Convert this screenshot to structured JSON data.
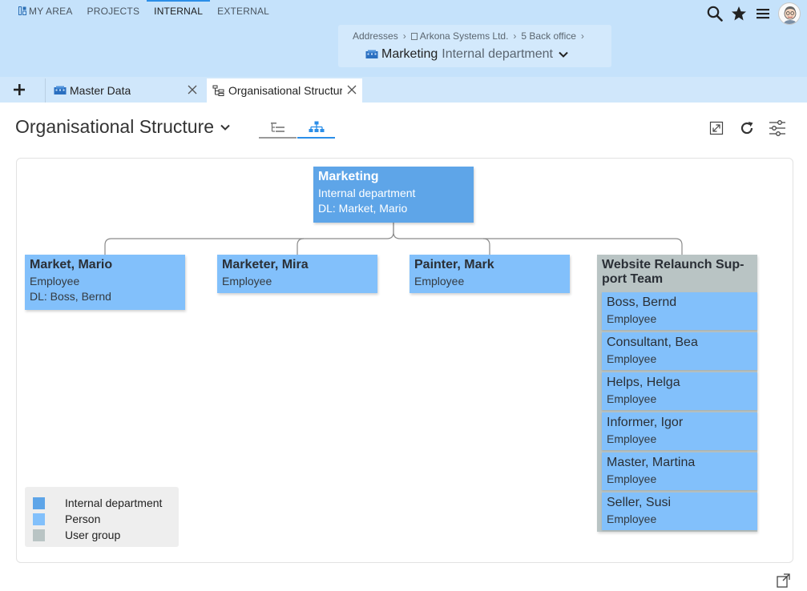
{
  "nav": {
    "items": [
      {
        "label": "MY AREA"
      },
      {
        "label": "PROJECTS"
      },
      {
        "label": "INTERNAL"
      },
      {
        "label": "EXTERNAL"
      }
    ],
    "active": "INTERNAL"
  },
  "breadcrumb": {
    "items": [
      "Addresses",
      "Arkona Systems Ltd.",
      "5 Back office"
    ],
    "title": "Marketing",
    "subtitle": "Internal department"
  },
  "tabs": [
    {
      "label": "Master Data"
    },
    {
      "label": "Organisational Structure"
    }
  ],
  "page": {
    "title": "Organisational Structure"
  },
  "org": {
    "root": {
      "name": "Marketing",
      "type": "Internal department",
      "lead": "DL: Market, Mario"
    },
    "children": [
      {
        "name": "Market, Mario",
        "role": "Employee",
        "lead": "DL: Boss, Bernd"
      },
      {
        "name": "Marketer, Mira",
        "role": "Employee"
      },
      {
        "name": "Painter, Mark",
        "role": "Employee"
      }
    ],
    "group": {
      "title": "Website Relaunch Sup-port Team",
      "members": [
        {
          "name": "Boss, Bernd",
          "role": "Employee"
        },
        {
          "name": "Consultant, Bea",
          "role": "Employee"
        },
        {
          "name": "Helps, Helga",
          "role": "Employee"
        },
        {
          "name": "Informer, Igor",
          "role": "Employee"
        },
        {
          "name": "Master, Martina",
          "role": "Employee"
        },
        {
          "name": "Seller, Susi",
          "role": "Employee"
        }
      ]
    }
  },
  "legend": [
    {
      "label": "Internal department",
      "color": "#5ea5e8"
    },
    {
      "label": "Person",
      "color": "#82c0fb"
    },
    {
      "label": "User group",
      "color": "#b9c4c4"
    }
  ],
  "icons": {
    "search": "search-icon",
    "favorites": "star-icon",
    "menu": "hamburger-menu-icon",
    "avatar": "user-avatar",
    "add_tab": "plus-icon",
    "close": "close-icon",
    "dropdown": "chevron-down-icon",
    "list_view": "list-tree-icon",
    "org_view": "org-chart-icon",
    "expand": "expand-icon",
    "refresh": "refresh-icon",
    "settings": "sliders-icon",
    "export": "export-icon"
  },
  "colors": {
    "header_bg": "#c5e2fb",
    "accent": "#2b8ee8",
    "department": "#5ea5e8",
    "person": "#82c0fb",
    "user_group": "#b9c4c4"
  }
}
